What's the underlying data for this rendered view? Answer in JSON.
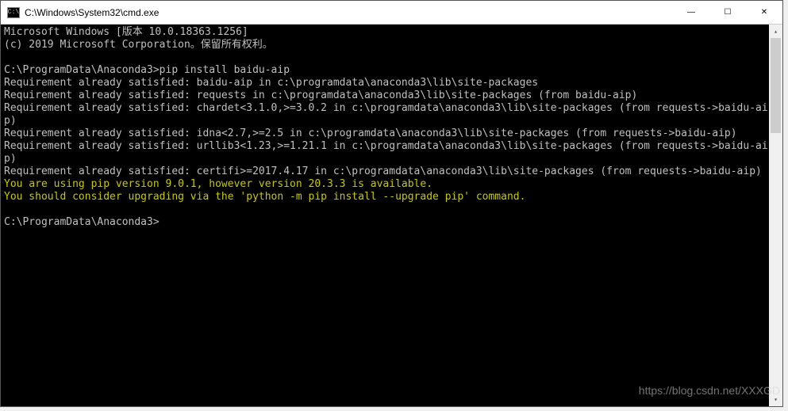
{
  "titlebar": {
    "icon_label": "C:\\",
    "title": "C:\\Windows\\System32\\cmd.exe",
    "minimize": "—",
    "maximize": "☐",
    "close": "✕"
  },
  "terminal": {
    "lines": [
      {
        "t": "Microsoft Windows [版本 10.0.18363.1256]",
        "c": "normal"
      },
      {
        "t": "(c) 2019 Microsoft Corporation。保留所有权利。",
        "c": "normal"
      },
      {
        "t": "",
        "c": "normal"
      },
      {
        "t": "C:\\ProgramData\\Anaconda3>pip install baidu-aip",
        "c": "normal"
      },
      {
        "t": "Requirement already satisfied: baidu-aip in c:\\programdata\\anaconda3\\lib\\site-packages",
        "c": "normal"
      },
      {
        "t": "Requirement already satisfied: requests in c:\\programdata\\anaconda3\\lib\\site-packages (from baidu-aip)",
        "c": "normal"
      },
      {
        "t": "Requirement already satisfied: chardet<3.1.0,>=3.0.2 in c:\\programdata\\anaconda3\\lib\\site-packages (from requests->baidu-aip)",
        "c": "normal"
      },
      {
        "t": "Requirement already satisfied: idna<2.7,>=2.5 in c:\\programdata\\anaconda3\\lib\\site-packages (from requests->baidu-aip)",
        "c": "normal"
      },
      {
        "t": "Requirement already satisfied: urllib3<1.23,>=1.21.1 in c:\\programdata\\anaconda3\\lib\\site-packages (from requests->baidu-aip)",
        "c": "normal"
      },
      {
        "t": "Requirement already satisfied: certifi>=2017.4.17 in c:\\programdata\\anaconda3\\lib\\site-packages (from requests->baidu-aip)",
        "c": "normal"
      },
      {
        "t": "You are using pip version 9.0.1, however version 20.3.3 is available.",
        "c": "yellow"
      },
      {
        "t": "You should consider upgrading via the 'python -m pip install --upgrade pip' command.",
        "c": "yellow"
      },
      {
        "t": "",
        "c": "normal"
      },
      {
        "t": "C:\\ProgramData\\Anaconda3>",
        "c": "normal"
      }
    ]
  },
  "scrollbar": {
    "up": "▴",
    "down": "▾"
  },
  "watermark": "https://blog.csdn.net/XXXGD"
}
